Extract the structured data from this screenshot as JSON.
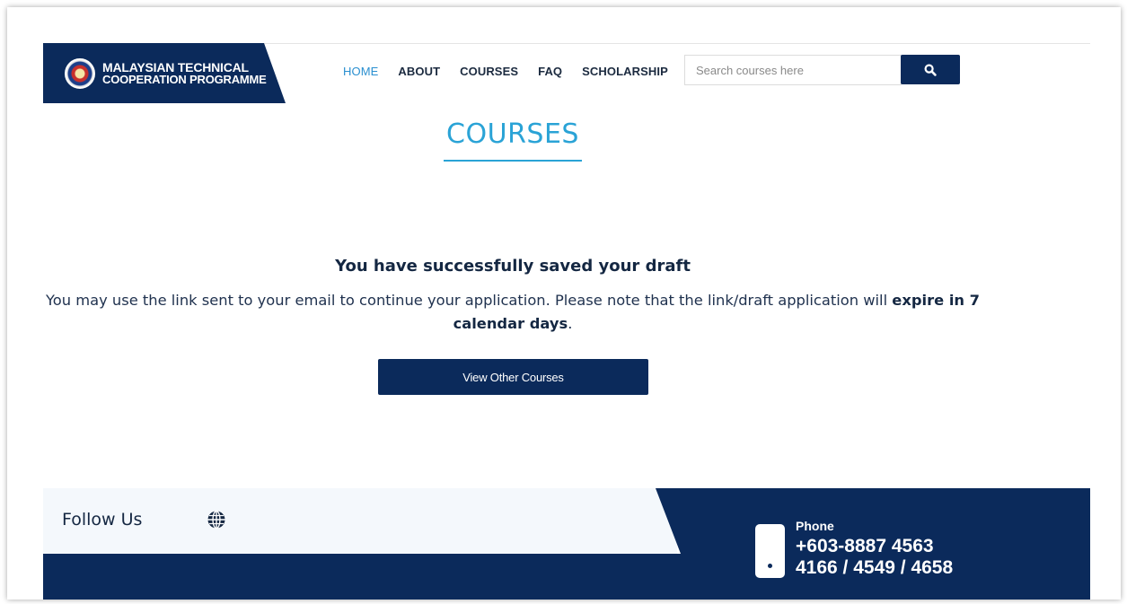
{
  "header": {
    "logo_line1": "MALAYSIAN TECHNICAL",
    "logo_line2": "COOPERATION PROGRAMME",
    "nav": [
      {
        "label": "HOME",
        "active": true
      },
      {
        "label": "ABOUT"
      },
      {
        "label": "COURSES"
      },
      {
        "label": "FAQ"
      },
      {
        "label": "SCHOLARSHIP"
      }
    ],
    "search": {
      "placeholder": "Search courses here",
      "value": ""
    }
  },
  "main": {
    "title": "COURSES",
    "success_title": "You have successfully saved your draft",
    "message_part1": "You may use the link sent to your email to continue your application. Please note that the link/draft application will ",
    "message_bold": "expire in 7 calendar days",
    "message_end": ".",
    "button_label": "View Other Courses"
  },
  "footer": {
    "follow_label": "Follow Us",
    "phone_label": "Phone",
    "phone_number_line1": "+603-8887 4563",
    "phone_number_line2": "4166 / 4549 / 4658"
  },
  "colors": {
    "navy": "#0b2a5b",
    "accent_blue": "#2aa3d6",
    "active_nav": "#2a8fd0"
  },
  "icons": [
    "search-icon",
    "globe-icon",
    "phone-icon"
  ]
}
